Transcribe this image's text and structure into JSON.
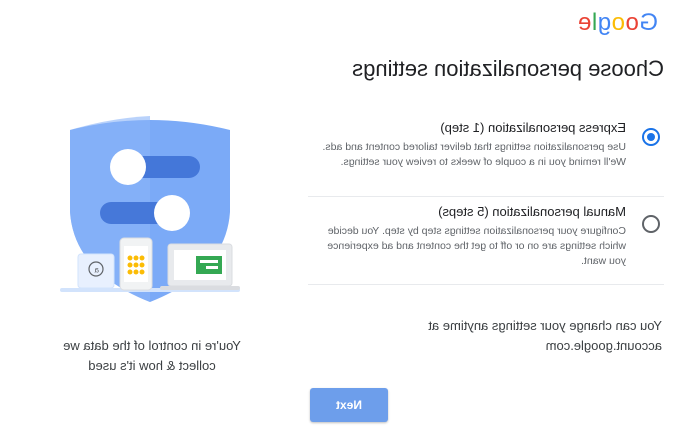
{
  "brand": {
    "logo_letters": [
      "G",
      "o",
      "o",
      "g",
      "l",
      "e"
    ],
    "logo_colors": [
      "#4285f4",
      "#ea4335",
      "#fbbc05",
      "#4285f4",
      "#34a853",
      "#ea4335"
    ]
  },
  "title": "Choose personalization settings",
  "options": [
    {
      "title": "Express personalization (1 step)",
      "description": "Use personalization settings that deliver tailored content and ads. We'll remind you in a couple of weeks to review your settings.",
      "selected": true
    },
    {
      "title": "Manual personalization (5 steps)",
      "description": "Configure your personalization settings step by step. You decide which settings are on or off to get the content and ad experience you want.",
      "selected": false
    }
  ],
  "change_note": "You can change your settings anytime at account.google.com",
  "next_label": "Next",
  "illustration": {
    "tagline": "You're in control of the data we collect & how it's used",
    "accent_color": "#4285f4"
  }
}
